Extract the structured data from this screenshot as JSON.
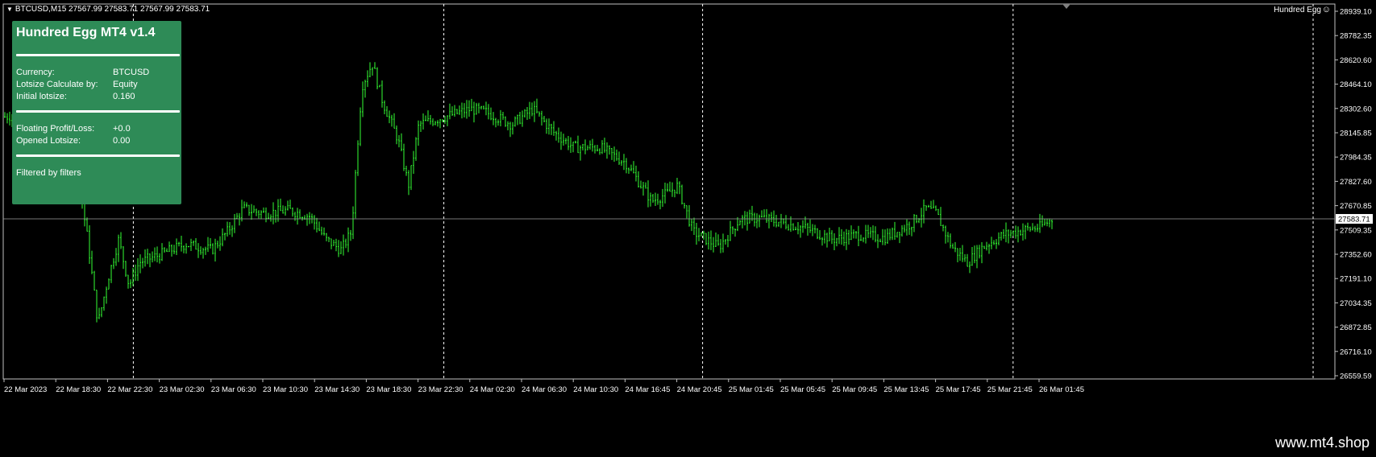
{
  "header": {
    "symbol_info": "BTCUSD,M15  27567.99 27583.71 27567.99 27583.71",
    "indicator_name": "Hundred Egg",
    "indicator_icon": "smiley-icon"
  },
  "panel": {
    "title": "Hundred Egg MT4 v1.4",
    "currency_label": "Currency:",
    "currency_value": "BTCUSD",
    "lotsize_calc_label": "Lotsize Calculate by:",
    "lotsize_calc_value": "Equity",
    "initial_lotsize_label": "Initial lotsize:",
    "initial_lotsize_value": "0.160",
    "floating_label": "Floating Profit/Loss:",
    "floating_value": "+0.0",
    "opened_label": "Opened Lotsize:",
    "opened_value": "0.00",
    "filter_text": "Filtered by filters",
    "background_color": "#2e8b57"
  },
  "watermark": "www.mt4.shop",
  "chart_data": {
    "type": "candlestick",
    "symbol": "BTCUSD",
    "timeframe": "M15",
    "current_price": 27583.71,
    "current_price_label": "27583.71",
    "candle_color": "#33ff33",
    "ylim": [
      26559.59,
      28939.1
    ],
    "y_ticks": [
      "28939.10",
      "28782.35",
      "28620.60",
      "28464.10",
      "28302.60",
      "28145.85",
      "27984.35",
      "27827.60",
      "27670.85",
      "27509.35",
      "27352.60",
      "27191.10",
      "27034.35",
      "26872.85",
      "26716.10",
      "26559.59"
    ],
    "x_ticks": [
      "22 Mar 2023",
      "22 Mar 18:30",
      "22 Mar 22:30",
      "23 Mar 02:30",
      "23 Mar 06:30",
      "23 Mar 10:30",
      "23 Mar 14:30",
      "23 Mar 18:30",
      "23 Mar 22:30",
      "24 Mar 02:30",
      "24 Mar 06:30",
      "24 Mar 10:30",
      "24 Mar 16:45",
      "24 Mar 20:45",
      "25 Mar 01:45",
      "25 Mar 05:45",
      "25 Mar 09:45",
      "25 Mar 13:45",
      "25 Mar 17:45",
      "25 Mar 21:45",
      "26 Mar 01:45"
    ],
    "period_separators": [
      2,
      8,
      13,
      19
    ],
    "close_path": [
      [
        0,
        28250
      ],
      [
        0.8,
        28300
      ],
      [
        1.4,
        27900
      ],
      [
        1.6,
        27450
      ],
      [
        1.8,
        26900
      ],
      [
        2.0,
        27200
      ],
      [
        2.2,
        27450
      ],
      [
        2.4,
        27150
      ],
      [
        2.6,
        27300
      ],
      [
        3.0,
        27350
      ],
      [
        3.5,
        27420
      ],
      [
        4.0,
        27380
      ],
      [
        4.3,
        27500
      ],
      [
        4.6,
        27650
      ],
      [
        5.0,
        27620
      ],
      [
        5.5,
        27640
      ],
      [
        5.9,
        27600
      ],
      [
        6.2,
        27450
      ],
      [
        6.5,
        27380
      ],
      [
        6.7,
        27500
      ],
      [
        6.8,
        28000
      ],
      [
        6.9,
        28450
      ],
      [
        7.1,
        28600
      ],
      [
        7.3,
        28350
      ],
      [
        7.6,
        28100
      ],
      [
        7.8,
        27800
      ],
      [
        8.0,
        28200
      ],
      [
        8.5,
        28250
      ],
      [
        9.0,
        28300
      ],
      [
        9.3,
        28280
      ],
      [
        9.8,
        28200
      ],
      [
        10.2,
        28300
      ],
      [
        10.6,
        28150
      ],
      [
        11.0,
        28050
      ],
      [
        11.5,
        28050
      ],
      [
        12.0,
        27950
      ],
      [
        12.5,
        27700
      ],
      [
        12.8,
        27750
      ],
      [
        13.0,
        27800
      ],
      [
        13.3,
        27500
      ],
      [
        13.8,
        27400
      ],
      [
        14.2,
        27580
      ],
      [
        14.6,
        27590
      ],
      [
        15.0,
        27560
      ],
      [
        15.5,
        27520
      ],
      [
        16.0,
        27450
      ],
      [
        16.5,
        27480
      ],
      [
        17.0,
        27460
      ],
      [
        17.5,
        27550
      ],
      [
        17.8,
        27650
      ],
      [
        18.0,
        27620
      ],
      [
        18.3,
        27400
      ],
      [
        18.6,
        27300
      ],
      [
        18.9,
        27400
      ],
      [
        19.3,
        27480
      ],
      [
        19.8,
        27520
      ],
      [
        20.0,
        27530
      ],
      [
        20.25,
        27583
      ]
    ]
  }
}
